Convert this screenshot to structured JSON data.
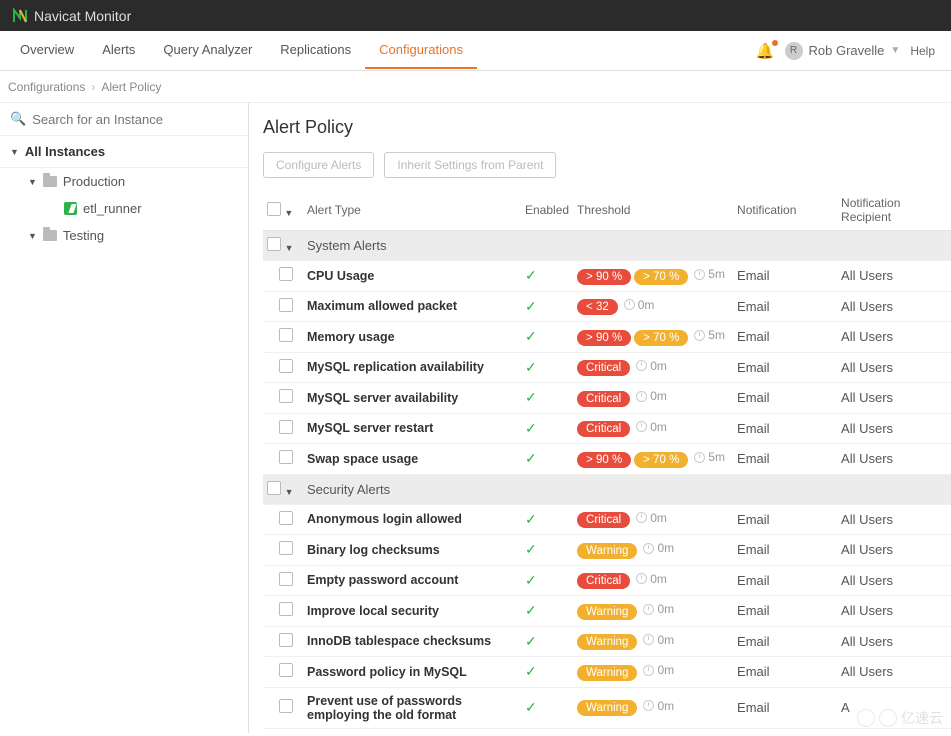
{
  "brand": "Navicat Monitor",
  "nav": {
    "items": [
      "Overview",
      "Alerts",
      "Query Analyzer",
      "Replications",
      "Configurations"
    ],
    "activeIndex": 4
  },
  "user": {
    "initial": "R",
    "name": "Rob Gravelle",
    "help": "Help"
  },
  "breadcrumb": {
    "root": "Configurations",
    "leaf": "Alert Policy"
  },
  "search": {
    "placeholder": "Search for an Instance"
  },
  "sidebar": {
    "allInstances": "All Instances",
    "nodes": [
      {
        "label": "Production",
        "type": "folder",
        "children": [
          {
            "label": "etl_runner",
            "type": "db"
          }
        ]
      },
      {
        "label": "Testing",
        "type": "folder",
        "children": []
      }
    ]
  },
  "page": {
    "title": "Alert Policy",
    "buttons": {
      "configure": "Configure Alerts",
      "inherit": "Inherit Settings from Parent"
    },
    "columns": {
      "alertType": "Alert Type",
      "enabled": "Enabled",
      "threshold": "Threshold",
      "notification": "Notification",
      "recipient": "Notification Recipient"
    },
    "groups": [
      {
        "name": "System Alerts",
        "rows": [
          {
            "type": "CPU Usage",
            "enabled": true,
            "pills": [
              "> 90 %",
              "> 70 %"
            ],
            "pillColors": [
              "red",
              "orange"
            ],
            "time": "5m",
            "notif": "Email",
            "rec": "All Users"
          },
          {
            "type": "Maximum allowed packet",
            "enabled": true,
            "pills": [
              "< 32"
            ],
            "pillColors": [
              "red"
            ],
            "time": "0m",
            "notif": "Email",
            "rec": "All Users"
          },
          {
            "type": "Memory usage",
            "enabled": true,
            "pills": [
              "> 90 %",
              "> 70 %"
            ],
            "pillColors": [
              "red",
              "orange"
            ],
            "time": "5m",
            "notif": "Email",
            "rec": "All Users"
          },
          {
            "type": "MySQL replication availability",
            "enabled": true,
            "pills": [
              "Critical"
            ],
            "pillColors": [
              "red"
            ],
            "time": "0m",
            "notif": "Email",
            "rec": "All Users"
          },
          {
            "type": "MySQL server availability",
            "enabled": true,
            "pills": [
              "Critical"
            ],
            "pillColors": [
              "red"
            ],
            "time": "0m",
            "notif": "Email",
            "rec": "All Users"
          },
          {
            "type": "MySQL server restart",
            "enabled": true,
            "pills": [
              "Critical"
            ],
            "pillColors": [
              "red"
            ],
            "time": "0m",
            "notif": "Email",
            "rec": "All Users"
          },
          {
            "type": "Swap space usage",
            "enabled": true,
            "pills": [
              "> 90 %",
              "> 70 %"
            ],
            "pillColors": [
              "red",
              "orange"
            ],
            "time": "5m",
            "notif": "Email",
            "rec": "All Users"
          }
        ]
      },
      {
        "name": "Security Alerts",
        "rows": [
          {
            "type": "Anonymous login allowed",
            "enabled": true,
            "pills": [
              "Critical"
            ],
            "pillColors": [
              "red"
            ],
            "time": "0m",
            "notif": "Email",
            "rec": "All Users"
          },
          {
            "type": "Binary log checksums",
            "enabled": true,
            "pills": [
              "Warning"
            ],
            "pillColors": [
              "orange"
            ],
            "time": "0m",
            "notif": "Email",
            "rec": "All Users"
          },
          {
            "type": "Empty password account",
            "enabled": true,
            "pills": [
              "Critical"
            ],
            "pillColors": [
              "red"
            ],
            "time": "0m",
            "notif": "Email",
            "rec": "All Users"
          },
          {
            "type": "Improve local security",
            "enabled": true,
            "pills": [
              "Warning"
            ],
            "pillColors": [
              "orange"
            ],
            "time": "0m",
            "notif": "Email",
            "rec": "All Users"
          },
          {
            "type": "InnoDB tablespace checksums",
            "enabled": true,
            "pills": [
              "Warning"
            ],
            "pillColors": [
              "orange"
            ],
            "time": "0m",
            "notif": "Email",
            "rec": "All Users"
          },
          {
            "type": "Password policy in MySQL",
            "enabled": true,
            "pills": [
              "Warning"
            ],
            "pillColors": [
              "orange"
            ],
            "time": "0m",
            "notif": "Email",
            "rec": "All Users"
          },
          {
            "type": "Prevent use of passwords employing the old format",
            "enabled": true,
            "pills": [
              "Warning"
            ],
            "pillColors": [
              "orange"
            ],
            "time": "0m",
            "notif": "Email",
            "rec": "A"
          }
        ]
      }
    ]
  },
  "watermark": "亿速云"
}
